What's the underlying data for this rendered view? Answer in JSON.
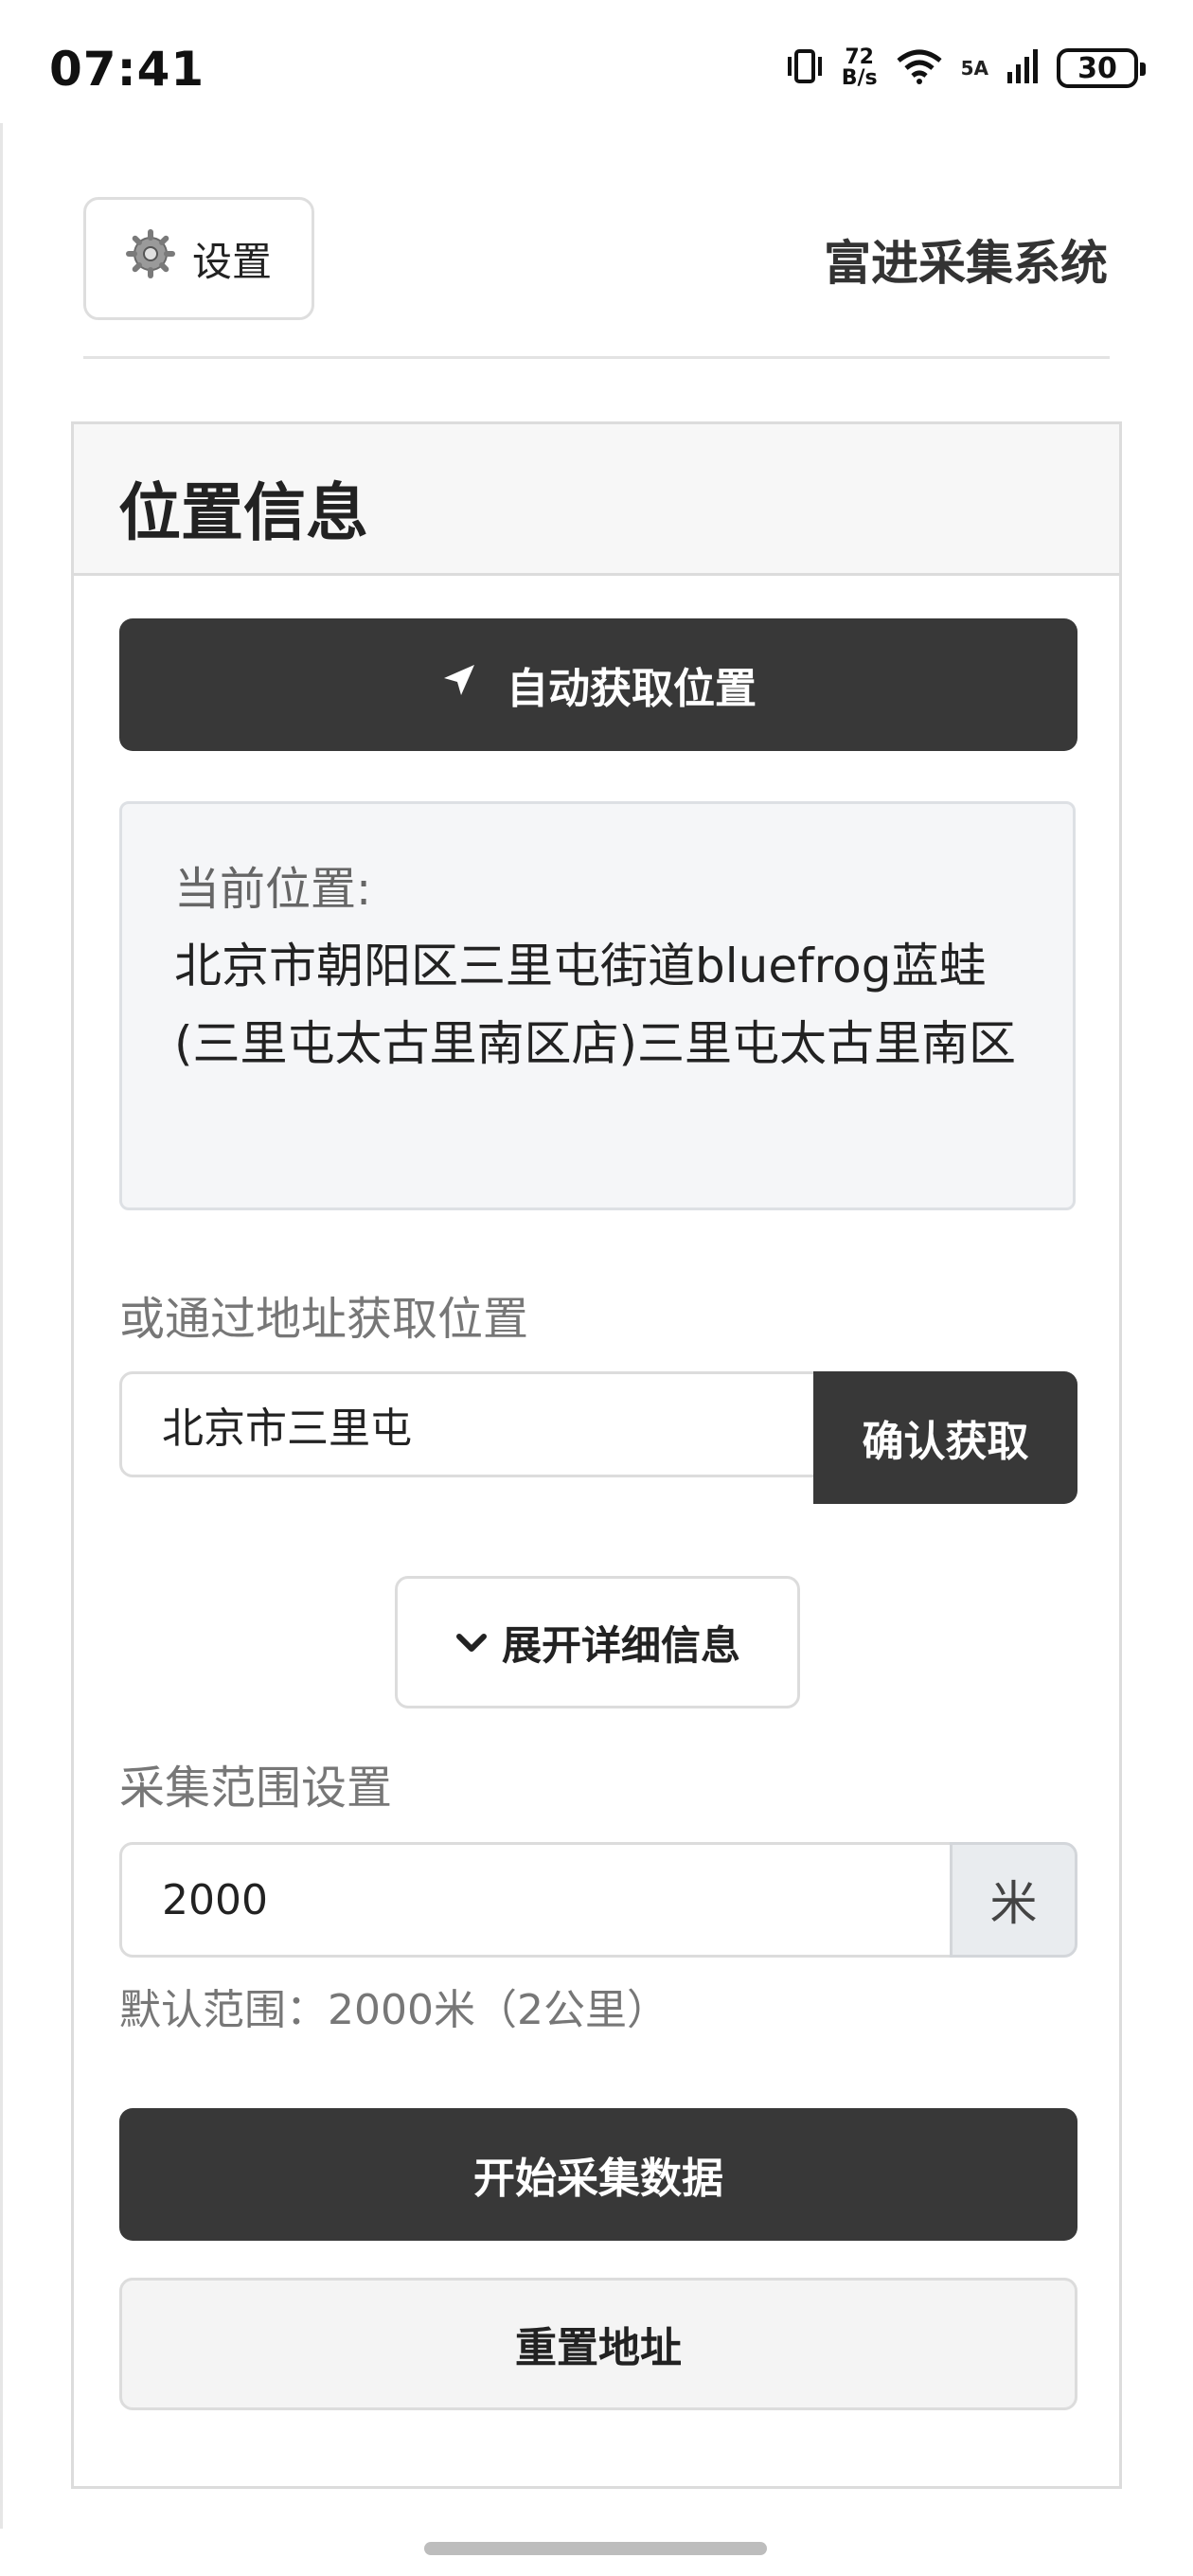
{
  "status_bar": {
    "time": "07:41",
    "net_speed_value": "72",
    "net_speed_unit": "B/s",
    "signal_label": "5A",
    "battery": "30"
  },
  "header": {
    "settings_label": "设置",
    "brand": "富进采集系统"
  },
  "card": {
    "title": "位置信息",
    "auto_locate_label": "自动获取位置",
    "current_location_label": "当前位置:",
    "current_location_value": "北京市朝阳区三里屯街道bluefrog蓝蛙(三里屯太古里南区店)三里屯太古里南区",
    "address_section_label": "或通过地址获取位置",
    "address_input_value": "北京市三里屯",
    "confirm_label": "确认获取",
    "expand_label": "展开详细信息",
    "range_section_label": "采集范围设置",
    "range_value": "2000",
    "range_unit": "米",
    "range_hint": "默认范围：2000米（2公里）",
    "start_label": "开始采集数据",
    "reset_label": "重置地址"
  },
  "icons": {
    "settings": "gear-icon",
    "locate": "navigation-arrow-icon",
    "expand": "chevron-down-icon"
  },
  "colors": {
    "primary_button": "#383838",
    "card_header_bg": "#f7f7f7",
    "location_box_bg": "#f5f6f8"
  }
}
